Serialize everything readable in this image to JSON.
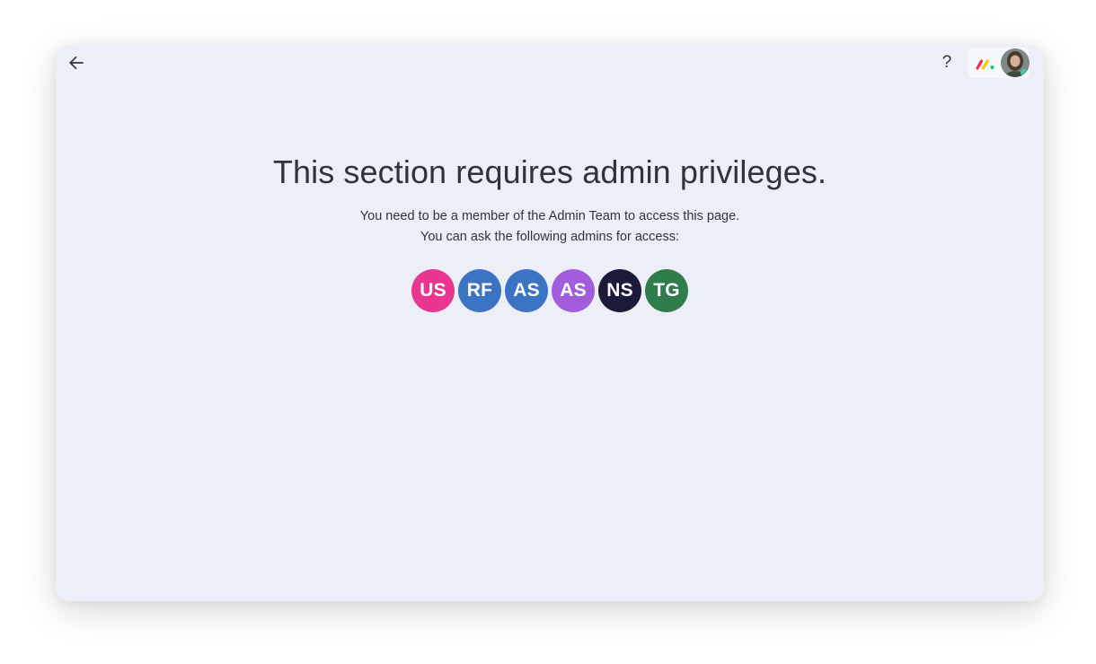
{
  "header": {
    "back_icon": "arrow-left-icon",
    "help_label": "?",
    "logo_icon": "monday-logo-icon",
    "user_avatar_icon": "user-photo-avatar"
  },
  "main": {
    "title": "This section requires admin privileges.",
    "line1": "You need to be a member of the Admin Team to access this page.",
    "line2": "You can ask the following admins for access:"
  },
  "admins": [
    {
      "initials": "US",
      "color": "#e8368f"
    },
    {
      "initials": "RF",
      "color": "#3a74c2"
    },
    {
      "initials": "AS",
      "color": "#3a74c2"
    },
    {
      "initials": "AS",
      "color": "#a25ddc"
    },
    {
      "initials": "NS",
      "color": "#1b1a3a"
    },
    {
      "initials": "TG",
      "color": "#2e7d4b"
    }
  ],
  "colors": {
    "background": "#eceff7",
    "text": "#323338",
    "logo_red": "#f62b54",
    "logo_yellow": "#ffcc00",
    "logo_green": "#00ca72"
  }
}
